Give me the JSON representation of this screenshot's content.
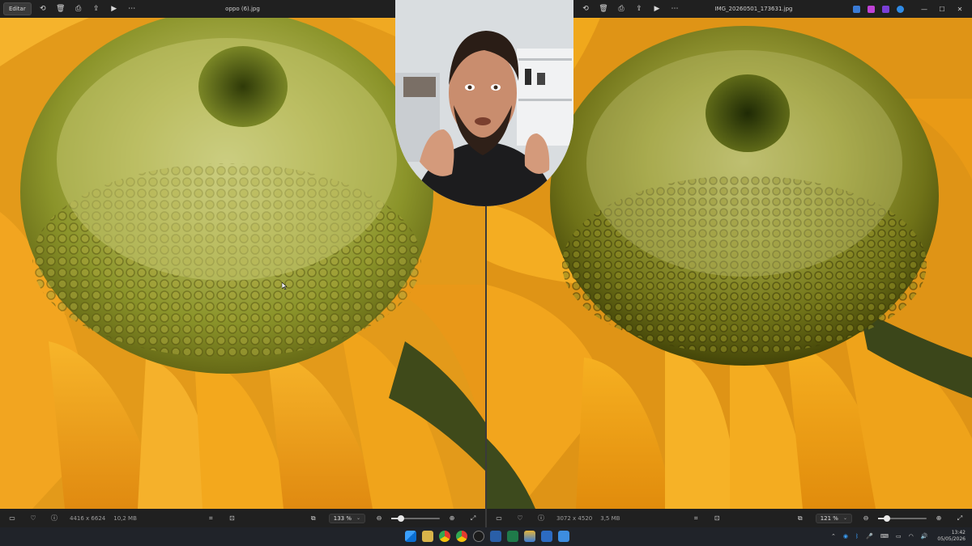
{
  "left_viewer": {
    "edit_label": "Editar",
    "file_name": "oppo (6).jpg",
    "dimensions": "4416 x 6624",
    "file_size": "10,2 MB",
    "zoom": "133 %",
    "zoom_level": 0.2
  },
  "right_viewer": {
    "file_name": "IMG_20260501_173631.jpg",
    "dimensions": "3072 x 4520",
    "file_size": "3,5 MB",
    "zoom": "121 %",
    "zoom_level": 0.18
  },
  "taskbar": {
    "time": "13:42",
    "date": "05/05/2026"
  },
  "colors": {
    "petal": "#f4a71a",
    "petal_dark": "#d2780b",
    "center": "#8f9a2a",
    "app_bg": "#202020"
  }
}
